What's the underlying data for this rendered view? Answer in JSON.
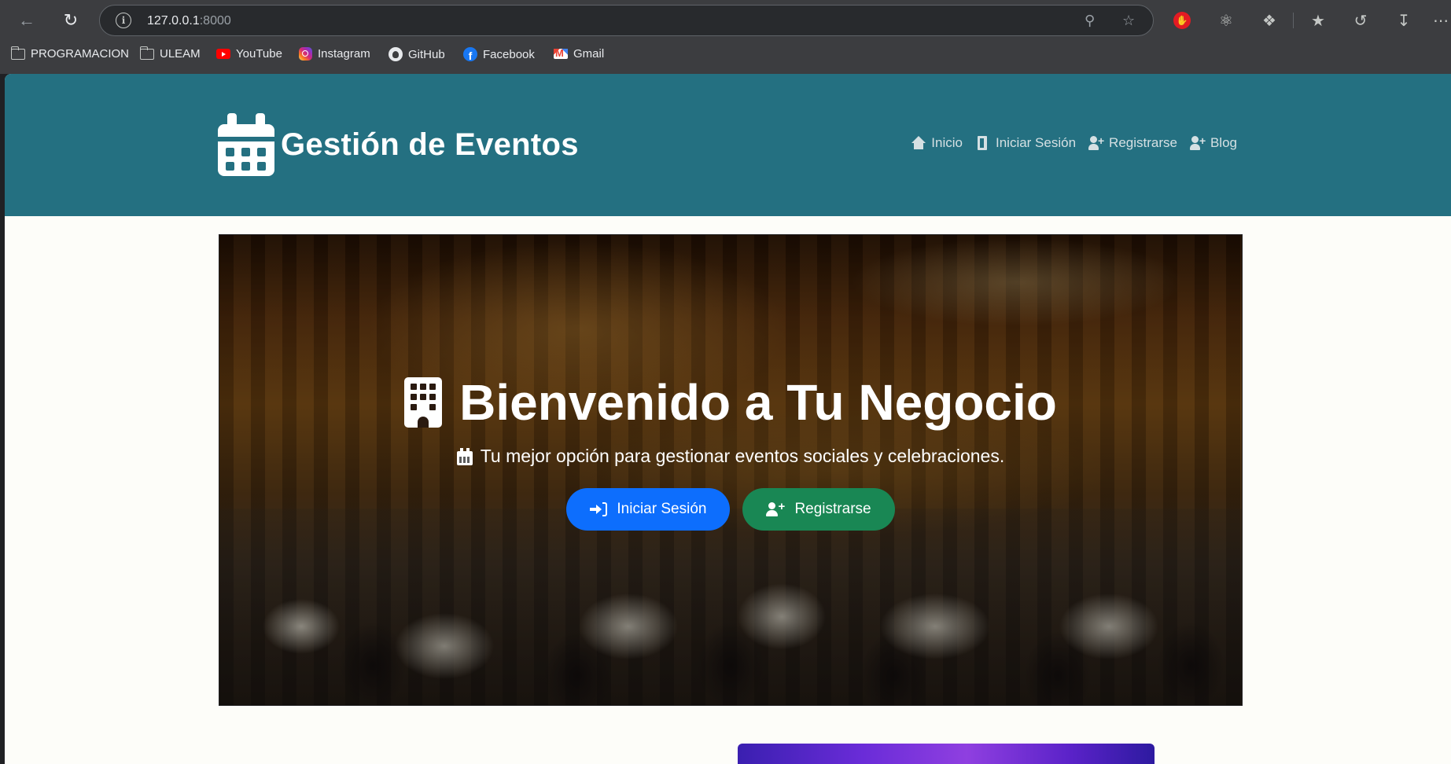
{
  "browser": {
    "url_host": "127.0.0.1",
    "url_port": ":8000",
    "bookmarks": [
      {
        "label": "PROGRAMACION",
        "icon": "folder-icon"
      },
      {
        "label": "ULEAM",
        "icon": "folder-icon"
      },
      {
        "label": "YouTube",
        "icon": "youtube-icon"
      },
      {
        "label": "Instagram",
        "icon": "instagram-icon"
      },
      {
        "label": "GitHub",
        "icon": "github-icon"
      },
      {
        "label": "Facebook",
        "icon": "facebook-icon"
      },
      {
        "label": "Gmail",
        "icon": "gmail-icon"
      }
    ]
  },
  "header": {
    "brand_title": "Gestión de Eventos",
    "nav": [
      {
        "label": "Inicio",
        "icon": "home-icon"
      },
      {
        "label": "Iniciar Sesión",
        "icon": "door-icon"
      },
      {
        "label": "Registrarse",
        "icon": "user-plus-icon"
      },
      {
        "label": "Blog",
        "icon": "user-plus-icon"
      }
    ]
  },
  "hero": {
    "title": "Bienvenido a Tu Negocio",
    "subtitle": "Tu mejor opción para gestionar eventos sociales y celebraciones.",
    "login_label": "Iniciar Sesión",
    "register_label": "Registrarse"
  },
  "colors": {
    "header_bg": "#247081",
    "primary_button": "#0d6efd",
    "success_button": "#198754",
    "page_bg": "#fdfdf9"
  }
}
